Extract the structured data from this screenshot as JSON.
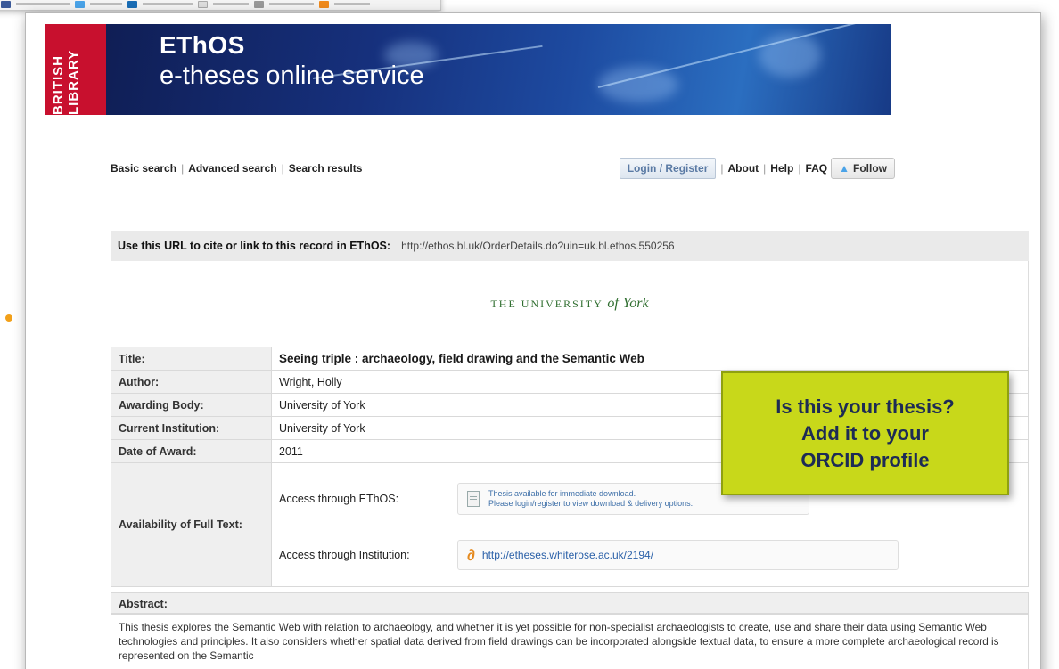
{
  "banner": {
    "badge_text": "BRITISH LIBRARY",
    "title": "EThOS",
    "subtitle": "e-theses online service"
  },
  "nav": {
    "basic_search": "Basic search",
    "advanced_search": "Advanced search",
    "search_results": "Search results",
    "login": "Login / Register",
    "about": "About",
    "help": "Help",
    "faq": "FAQ",
    "follow": "Follow"
  },
  "cite": {
    "label": "Use this URL to cite or link to this record in EThOS:",
    "url": "http://ethos.bl.uk/OrderDetails.do?uin=uk.bl.ethos.550256"
  },
  "university": {
    "logo_prefix": "THE UNIVERSITY",
    "logo_of": "of",
    "logo_name": "York"
  },
  "record": {
    "title_label": "Title:",
    "title": "Seeing triple : archaeology, field drawing and the Semantic Web",
    "author_label": "Author:",
    "author": "Wright, Holly",
    "awarding_label": "Awarding Body:",
    "awarding": "University of York",
    "institution_label": "Current Institution:",
    "institution": "University of York",
    "date_label": "Date of Award:",
    "date": "2011",
    "availability_label": "Availability of Full Text:",
    "access_ethos_label": "Access through EThOS:",
    "access_ethos_note1": "Thesis available for immediate download.",
    "access_ethos_note2": "Please login/register to view download & delivery options.",
    "access_inst_label": "Access through Institution:",
    "access_inst_url": "http://etheses.whiterose.ac.uk/2194/"
  },
  "abstract": {
    "label": "Abstract:",
    "text": "This thesis explores the Semantic Web with relation to archaeology, and whether it is yet possible for non-specialist archaeologists to create, use and share their data using Semantic Web technologies and principles. It also considers whether spatial data derived from field drawings can be incorporated alongside textual data, to ensure a more complete archaeological record is represented on the Semantic"
  },
  "callout": {
    "line1": "Is this your thesis?",
    "line2": "Add it to your",
    "line3": "ORCID profile"
  },
  "colors": {
    "callout_bg": "#c8d81a",
    "callout_text": "#1d2b55",
    "bl_red": "#c8102e",
    "banner_blue": "#16307c"
  }
}
